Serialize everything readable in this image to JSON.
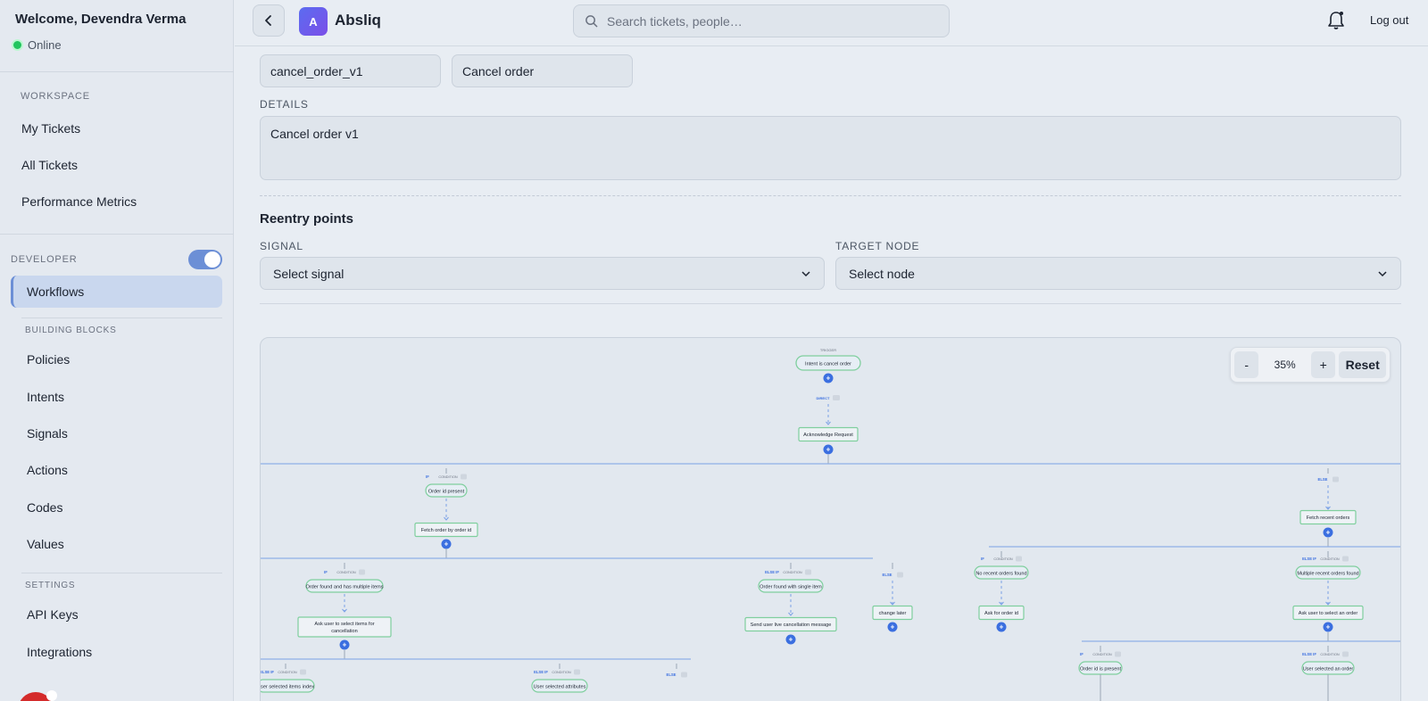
{
  "user": {
    "welcome": "Welcome, Devendra Verma",
    "status": "Online"
  },
  "sidebar": {
    "workspace_label": "WORKSPACE",
    "workspace_items": [
      "My Tickets",
      "All Tickets",
      "Performance Metrics"
    ],
    "developer_label": "DEVELOPER",
    "developer_toggle": true,
    "active_item": "Workflows",
    "building_blocks_label": "BUILDING BLOCKS",
    "building_blocks_items": [
      "Policies",
      "Intents",
      "Signals",
      "Actions",
      "Codes",
      "Values"
    ],
    "settings_label": "SETTINGS",
    "settings_items": [
      "API Keys",
      "Integrations"
    ]
  },
  "topbar": {
    "brand": "Absliq",
    "logo_letter": "A",
    "search_placeholder": "Search tickets, people…",
    "logout": "Log out"
  },
  "form": {
    "workflow_id": "cancel_order_v1",
    "workflow_name": "Cancel order",
    "details_label": "DETAILS",
    "details_value": "Cancel order v1",
    "reentry_heading": "Reentry points",
    "signal_label": "SIGNAL",
    "signal_placeholder": "Select signal",
    "target_label": "TARGET NODE",
    "target_placeholder": "Select node"
  },
  "zoom": {
    "minus": "-",
    "level": "35%",
    "plus": "+",
    "reset": "Reset"
  },
  "flow": {
    "trigger_label": "TRIGGER",
    "direct_label": "DIRECT",
    "if_label": "IF",
    "else_if_label": "ELSE IF",
    "else_label": "ELSE",
    "condition_label": "CONDITION",
    "nodes": {
      "trigger": "Intent is cancel order",
      "ack": "Acknowledge Request",
      "c_order_id": "Order id present",
      "a_fetch_by_id": "Fetch order by order id",
      "a_fetch_recent": "Fetch recent orders",
      "c_multi_items": "Order found and has multiple items",
      "a_select_items_1": "Ask user to select items for",
      "a_select_items_2": "cancellation",
      "c_single_item": "Order found with single item",
      "a_send_live": "Send user live cancellation message",
      "a_change_later": "change later",
      "c_no_recent": "No recent orders found",
      "a_ask_order_id": "Ask for order id",
      "c_multi_recent": "Multiple recent orders found",
      "a_select_order": "Ask user to select an order",
      "c_order_id_present": "Order id is present",
      "c_user_selected_order": "User selected an order",
      "c_user_selected_items": "User selected items index",
      "c_user_selected_attrs": "User selected attributes"
    }
  },
  "colors": {
    "accent": "#3b6fe0",
    "node_border": "#7fcf9e",
    "toggle": "#6c8fd6"
  }
}
